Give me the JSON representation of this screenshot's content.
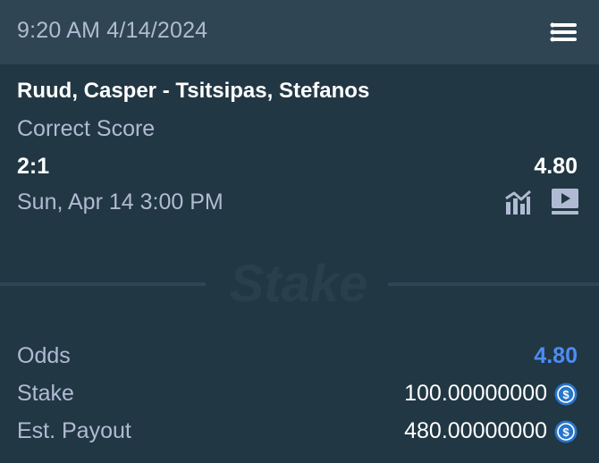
{
  "header": {
    "datetime": "9:20 AM 4/14/2024",
    "menu_icon": "hamburger-menu-icon"
  },
  "bet": {
    "match": "Ruud, Casper - Tsitsipas, Stefanos",
    "market": "Correct Score",
    "selection": "2:1",
    "selection_odds": "4.80",
    "event_date": "Sun, Apr 14 3:00 PM",
    "stats_icon": "stats-chart-icon",
    "live_icon": "live-stream-icon"
  },
  "brand": {
    "logo_text": "Stake"
  },
  "summary": {
    "odds_label": "Odds",
    "odds_value": "4.80",
    "stake_label": "Stake",
    "stake_value": "100.00000000",
    "payout_label": "Est. Payout",
    "payout_value": "480.00000000",
    "currency_icon": "usdc-coin-icon"
  },
  "colors": {
    "header_bg": "#2f4553",
    "body_bg": "#213743",
    "muted_text": "#b1bad3",
    "accent_blue": "#4d8cf5",
    "coin_blue": "#2775ca"
  }
}
